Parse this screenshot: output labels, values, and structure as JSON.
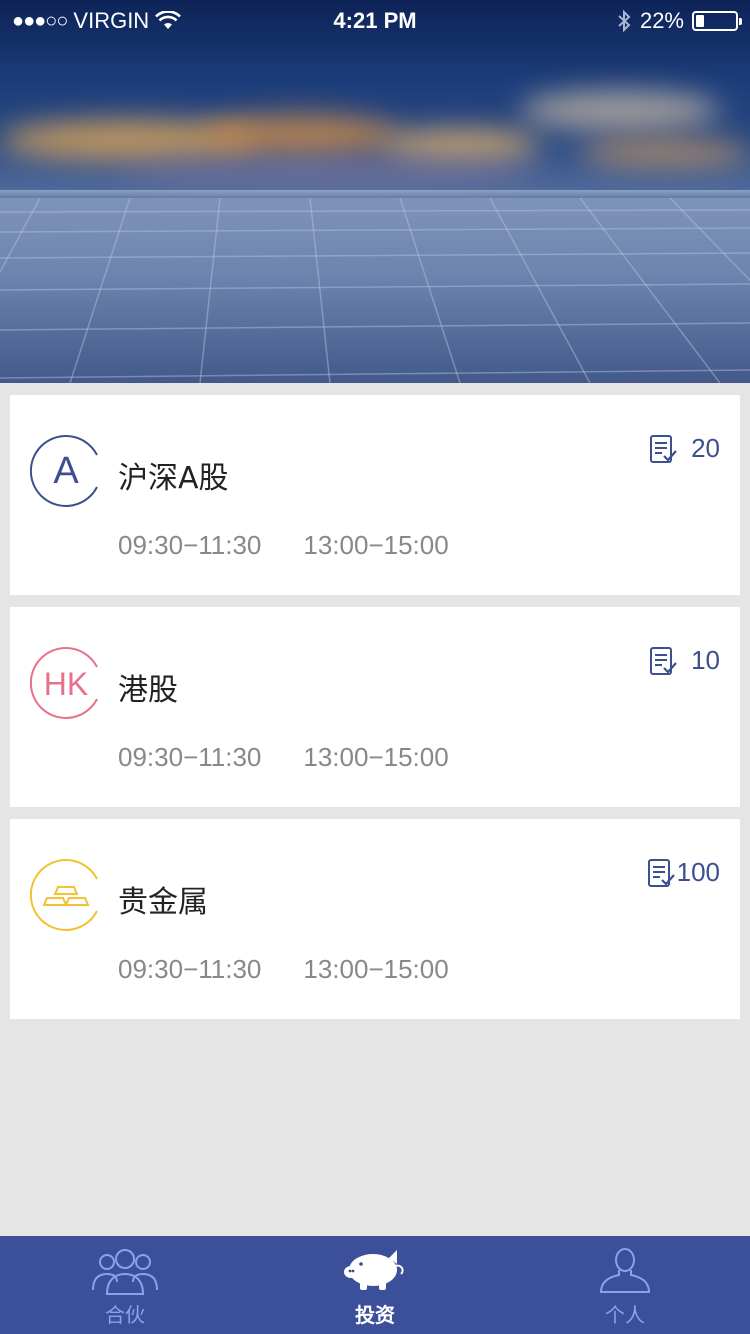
{
  "status_bar": {
    "signal": "●●●○○",
    "carrier": "VIRGIN",
    "time": "4:21 PM",
    "battery": "22%",
    "battery_level": 0.22
  },
  "markets": [
    {
      "logo_text": "A",
      "logo_color": "#3c4f8f",
      "name": "沪深A股",
      "session_1": "09:30−11:30",
      "session_2": "13:00−15:00",
      "count": "20"
    },
    {
      "logo_text": "HK",
      "logo_color": "#e8718a",
      "name": "港股",
      "session_1": "09:30−11:30",
      "session_2": "13:00−15:00",
      "count": "10"
    },
    {
      "logo_icon": "gold-bars-icon",
      "logo_color": "#f2c230",
      "name": "贵金属",
      "session_1": "09:30−11:30",
      "session_2": "13:00−15:00",
      "count": "100"
    }
  ],
  "tabs": [
    {
      "label": "合伙",
      "icon": "partners-icon",
      "active": false
    },
    {
      "label": "投资",
      "icon": "piggy-bank-icon",
      "active": true
    },
    {
      "label": "个人",
      "icon": "person-icon",
      "active": false
    }
  ],
  "colors": {
    "accent": "#3c4f9a",
    "count_text": "#3c4f8f",
    "tab_inactive": "#8aa2ea",
    "background": "#e5e5e5"
  }
}
